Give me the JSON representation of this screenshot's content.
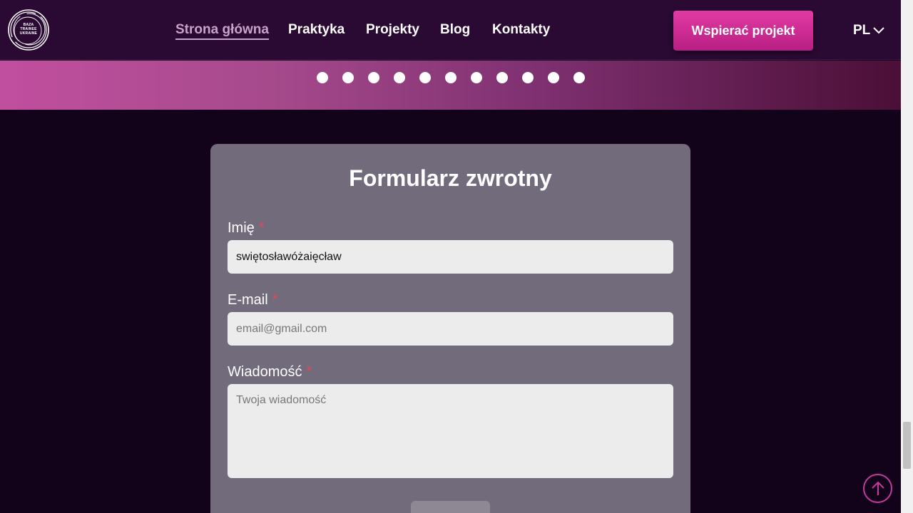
{
  "logo": {
    "lines": [
      "BAZA",
      "TRAINEE",
      "UKRAINE"
    ]
  },
  "nav": {
    "items": [
      {
        "label": "Strona główna",
        "active": true
      },
      {
        "label": "Praktyka",
        "active": false
      },
      {
        "label": "Projekty",
        "active": false
      },
      {
        "label": "Blog",
        "active": false
      },
      {
        "label": "Kontakty",
        "active": false
      }
    ],
    "support_button": "Wspierać projekt",
    "language": "PL"
  },
  "carousel": {
    "dot_count": 11
  },
  "form": {
    "title": "Formularz zwrotny",
    "name_label": "Imię",
    "name_value": "swiętosławóżaięcław",
    "email_label": "E-mail",
    "email_placeholder": "email@gmail.com",
    "message_label": "Wiadomość",
    "message_placeholder": "Twoja wiadomość",
    "required_mark": "*"
  },
  "colors": {
    "header_bg": "#2a0a33",
    "page_bg": "#12031a",
    "accent": "#e23aa4",
    "card_bg": "#726b7b",
    "required": "#e0485a"
  },
  "icons": {
    "logo": "circular-swirl-logo",
    "lang": "chevron-down-icon",
    "to_top": "arrow-up-circle-icon"
  }
}
